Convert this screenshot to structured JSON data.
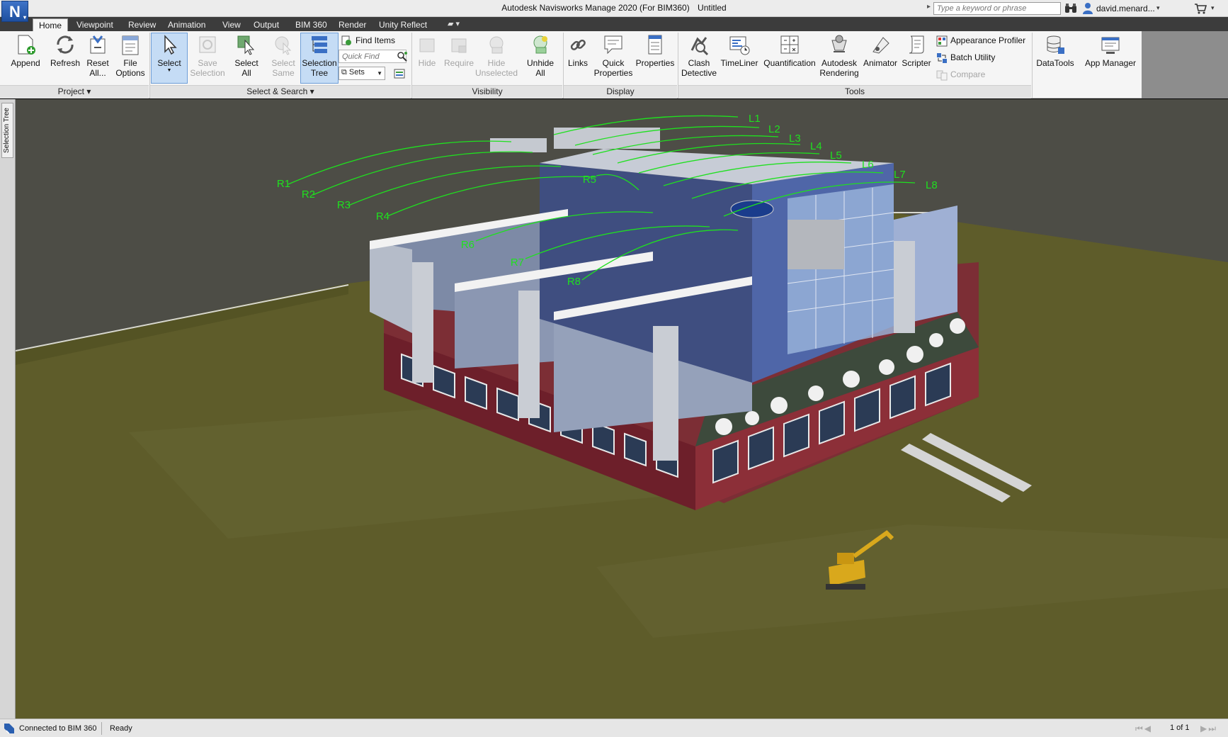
{
  "app": {
    "title": "Autodesk Navisworks Manage 2020 (For BIM360)",
    "document": "Untitled",
    "logo_letter": "N"
  },
  "search": {
    "placeholder": "Type a keyword or phrase"
  },
  "user": {
    "name": "david.menard..."
  },
  "tabs": [
    "Home",
    "Viewpoint",
    "Review",
    "Animation",
    "View",
    "Output",
    "BIM 360",
    "Render",
    "Unity Reflect"
  ],
  "active_tab": "Home",
  "ribbon": {
    "project": {
      "footer": "Project ▾",
      "append": "Append",
      "refresh": "Refresh",
      "reset_all": [
        "Reset",
        "All..."
      ],
      "file_options": [
        "File",
        "Options"
      ]
    },
    "select_search": {
      "footer": "Select & Search ▾",
      "select": "Select",
      "save_selection": [
        "Save",
        "Selection"
      ],
      "select_all": [
        "Select",
        "All"
      ],
      "select_same": [
        "Select",
        "Same"
      ],
      "selection_tree": [
        "Selection",
        "Tree"
      ],
      "find_items": "Find Items",
      "quick_find_placeholder": "Quick Find",
      "sets": "Sets"
    },
    "visibility": {
      "footer": "Visibility",
      "hide": "Hide",
      "require": "Require",
      "hide_unselected": [
        "Hide",
        "Unselected"
      ],
      "unhide_all": [
        "Unhide",
        "All"
      ]
    },
    "display": {
      "footer": "Display",
      "links": "Links",
      "quick_properties": [
        "Quick",
        "Properties"
      ],
      "properties": "Properties"
    },
    "tools": {
      "footer": "Tools",
      "clash_detective": [
        "Clash",
        "Detective"
      ],
      "timeliner": "TimeLiner",
      "quantification": "Quantification",
      "autodesk_rendering": [
        "Autodesk",
        "Rendering"
      ],
      "animator": "Animator",
      "scripter": "Scripter",
      "appearance_profiler": "Appearance Profiler",
      "batch_utility": "Batch Utility",
      "compare": "Compare"
    },
    "datatools": "DataTools",
    "app_manager": "App Manager"
  },
  "side_panel": {
    "label": "Selection Tree"
  },
  "scene": {
    "left_labels": [
      "L1",
      "L2",
      "L3",
      "L4",
      "L5",
      "L6",
      "L7",
      "L8"
    ],
    "right_labels": [
      "R1",
      "R2",
      "R3",
      "R4",
      "R5",
      "R6",
      "R7",
      "R8"
    ],
    "label_color": "#1fe01f",
    "ground_color": "#5e5c2a",
    "sky_color": "#4d4d46"
  },
  "status": {
    "connection": "Connected to BIM 360",
    "state": "Ready",
    "pages": "1 of 1"
  },
  "colors": {
    "accent": "#2a5fb0",
    "tab_bar": "#3c3c3c",
    "ribbon": "#f5f5f5"
  }
}
